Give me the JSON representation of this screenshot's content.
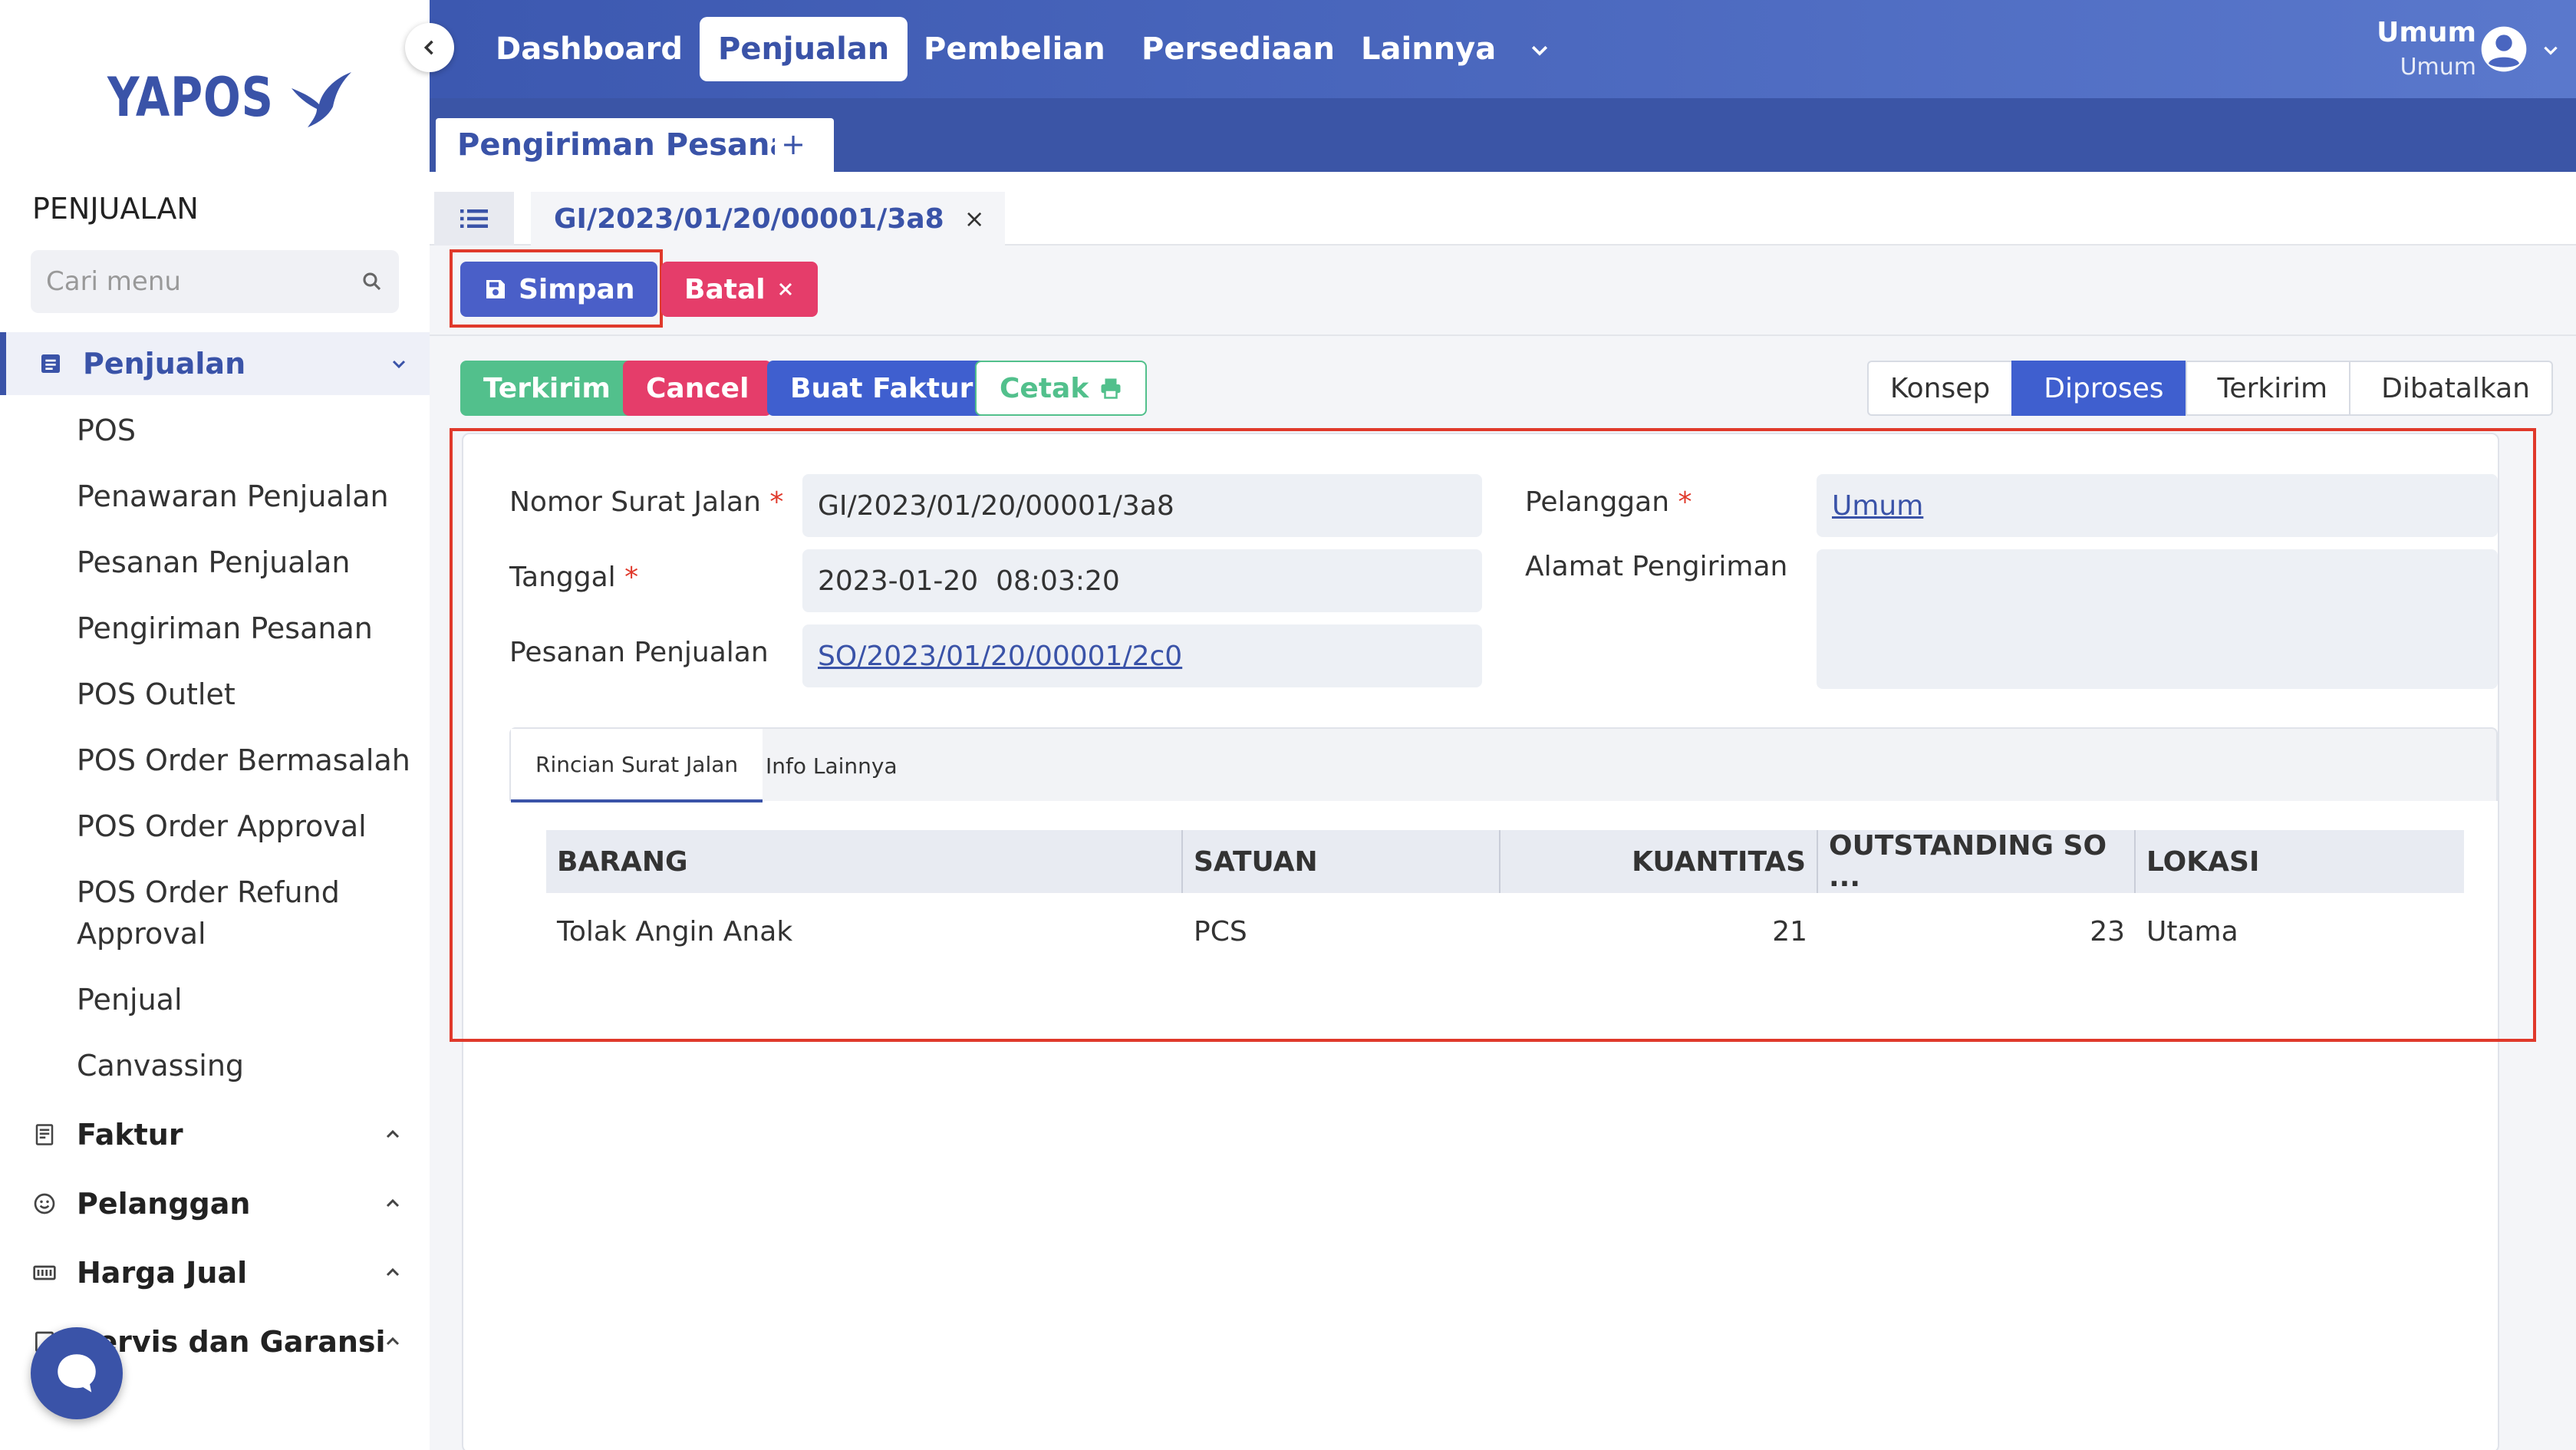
{
  "sidebar": {
    "logo_text": "YAPOS",
    "section_title": "PENJUALAN",
    "search_placeholder": "Cari menu",
    "groups": [
      {
        "label": "Penjualan",
        "icon": "document-list-icon",
        "expanded": true
      },
      {
        "label": "Faktur",
        "icon": "receipt-icon",
        "expanded": false
      },
      {
        "label": "Pelanggan",
        "icon": "smiley-icon",
        "expanded": false
      },
      {
        "label": "Harga Jual",
        "icon": "price-tag-icon",
        "expanded": false
      },
      {
        "label": "Servis dan Garansi",
        "icon": "wrench-icon",
        "expanded": false
      }
    ],
    "items": [
      {
        "label": "POS"
      },
      {
        "label": "Penawaran Penjualan"
      },
      {
        "label": "Pesanan Penjualan"
      },
      {
        "label": "Pengiriman Pesanan"
      },
      {
        "label": "POS Outlet"
      },
      {
        "label": "POS Order Bermasalah"
      },
      {
        "label": "POS Order Approval"
      },
      {
        "label": "POS Order Refund"
      },
      {
        "label": "Approval"
      },
      {
        "label": "Penjual"
      },
      {
        "label": "Canvassing"
      }
    ]
  },
  "topnav": {
    "items": [
      {
        "label": "Dashboard",
        "active": false
      },
      {
        "label": "Penjualan",
        "active": true
      },
      {
        "label": "Pembelian",
        "active": false
      },
      {
        "label": "Persediaan",
        "active": false
      },
      {
        "label": "Lainnya",
        "active": false
      }
    ],
    "user_name": "Umum",
    "user_role": "Umum"
  },
  "page_tab": {
    "label": "Pengiriman Pesanan",
    "add_label": "+"
  },
  "doc_tab": {
    "label": "GI/2023/01/20/00001/3a8",
    "close": "×"
  },
  "actions": {
    "simpan": "Simpan",
    "batal": "Batal"
  },
  "workflow_buttons": {
    "terkirim": "Terkirim",
    "cancel": "Cancel",
    "buat_faktur": "Buat Faktur",
    "cetak": "Cetak"
  },
  "status_steps": [
    {
      "label": "Konsep",
      "current": false
    },
    {
      "label": "Diproses",
      "current": true
    },
    {
      "label": "Terkirim",
      "current": false
    },
    {
      "label": "Dibatalkan",
      "current": false
    }
  ],
  "form": {
    "nomor_label": "Nomor Surat Jalan",
    "nomor_value": "GI/2023/01/20/00001/3a8",
    "tanggal_label": "Tanggal",
    "tanggal_value": "2023-01-20  08:03:20",
    "pesanan_label": "Pesanan Penjualan",
    "pesanan_value": "SO/2023/01/20/00001/2c0",
    "pelanggan_label": "Pelanggan",
    "pelanggan_value": "Umum",
    "alamat_label": "Alamat Pengiriman",
    "alamat_value": "",
    "required_mark": "*"
  },
  "subtabs": [
    {
      "label": "Rincian Surat Jalan",
      "active": true
    },
    {
      "label": "Info Lainnya",
      "active": false
    }
  ],
  "table": {
    "columns": [
      "BARANG",
      "SATUAN",
      "KUANTITAS",
      "OUTSTANDING SO ...",
      "LOKASI"
    ],
    "rows": [
      {
        "barang": "Tolak Angin Anak",
        "satuan": "PCS",
        "kuantitas": "21",
        "outstanding": "23",
        "lokasi": "Utama"
      }
    ]
  },
  "colors": {
    "brand": "#3a53a8",
    "success": "#52c08c",
    "danger": "#e53d6a",
    "primary": "#3f5fcf",
    "highlight": "#e0392b"
  }
}
